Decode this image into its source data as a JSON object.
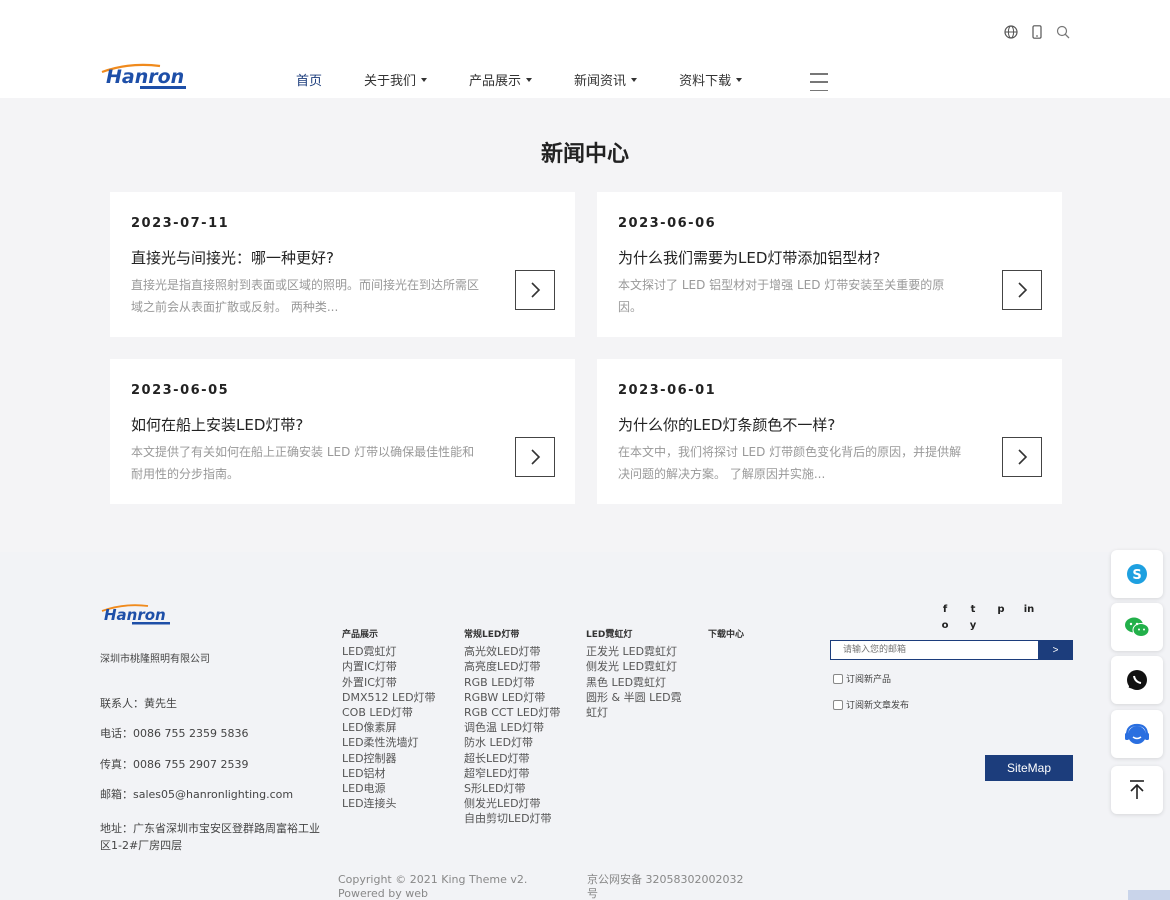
{
  "header": {
    "nav": [
      {
        "label": "首页"
      },
      {
        "label": "关于我们"
      },
      {
        "label": "产品展示"
      },
      {
        "label": "新闻资讯"
      },
      {
        "label": "资料下载"
      }
    ],
    "icons": [
      "globe-icon",
      "mobile-icon",
      "search-icon",
      "menu-icon"
    ]
  },
  "section": {
    "title": "新闻中心"
  },
  "articles": [
    {
      "date": "2023-07-11",
      "title": "直接光与间接光：哪一种更好?",
      "excerpt": "直接光是指直接照射到表面或区域的照明。而间接光在到达所需区域之前会从表面扩散或反射。 两种类..."
    },
    {
      "date": "2023-06-06",
      "title": "为什么我们需要为LED灯带添加铝型材?",
      "excerpt": "本文探讨了 LED 铝型材对于增强 LED 灯带安装至关重要的原因。"
    },
    {
      "date": "2023-06-05",
      "title": "如何在船上安装LED灯带?",
      "excerpt": "本文提供了有关如何在船上正确安装 LED 灯带以确保最佳性能和耐用性的分步指南。"
    },
    {
      "date": "2023-06-01",
      "title": "为什么你的LED灯条颜色不一样?",
      "excerpt": "在本文中，我们将探讨 LED 灯带颜色变化背后的原因，并提供解决问题的解决方案。 了解原因并实施..."
    }
  ],
  "footer": {
    "company": "深圳市桃隆照明有限公司",
    "contact_person": "联系人：黄先生",
    "phone": "电话：0086 755 2359 5836",
    "fax": "传真：0086 755 2907 2539",
    "email": "邮箱：sales05@hanronlighting.com",
    "address_line1": "地址：广东省深圳市宝安区登群路周富裕工业",
    "address_line2": "区1-2#厂房四层",
    "columns": [
      {
        "head": "产品展示",
        "links": [
          "LED霓虹灯",
          "内置IC灯带",
          "外置IC灯带",
          "DMX512 LED灯带",
          "COB LED灯带",
          "LED像素屏",
          "LED柔性洗墙灯",
          "LED控制器",
          "LED铝材",
          "LED电源",
          "LED连接头"
        ]
      },
      {
        "head": "常规LED灯带",
        "links": [
          "高光效LED灯带",
          "高亮度LED灯带",
          "RGB LED灯带",
          "RGBW LED灯带",
          "RGB CCT LED灯带",
          "调色温 LED灯带",
          "防水 LED灯带",
          "超长LED灯带",
          "超窄LED灯带",
          "S形LED灯带",
          "侧发光LED灯带",
          "自由剪切LED灯带"
        ]
      },
      {
        "head": "LED霓虹灯",
        "links": [
          "正发光 LED霓虹灯",
          "侧发光 LED霓虹灯",
          "黑色 LED霓虹灯",
          "圆形 & 半圆 LED霓",
          "虹灯"
        ]
      },
      {
        "head": "下载中心",
        "links": []
      }
    ],
    "social": [
      "f",
      "t",
      "p",
      "in",
      "o",
      "y"
    ],
    "subscribe_placeholder": "请输入您的邮箱",
    "subscribe_button": ">",
    "check_products": "订阅新产品",
    "check_articles": "订阅新文章发布",
    "sitemap": "SiteMap",
    "copyright_line1": "Copyright © 2021 King Theme v2.",
    "copyright_line2": "Powered by web",
    "icp_line1": "京公网安备 32058302002032",
    "icp_line2": "号"
  },
  "colors": {
    "brand_navy": "#1c3d7c",
    "logo_orange": "#f08a1c",
    "logo_blue": "#1e4fa8"
  }
}
